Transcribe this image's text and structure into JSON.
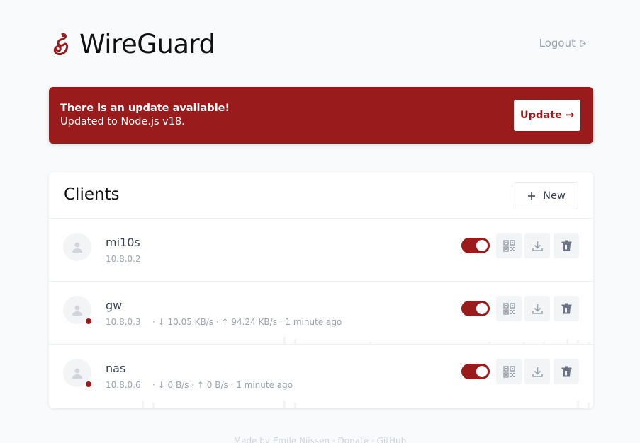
{
  "app": {
    "title": "WireGuard",
    "logout_label": "Logout",
    "accent": "#991b1b"
  },
  "banner": {
    "title": "There is an update available!",
    "message": "Updated to Node.js v18.",
    "button_label": "Update →"
  },
  "clients_card": {
    "title": "Clients",
    "new_label": "New"
  },
  "clients": [
    {
      "name": "mi10s",
      "ip": "10.8.0.2",
      "stats": "",
      "enabled": true,
      "connected": false
    },
    {
      "name": "gw",
      "ip": "10.8.0.3",
      "stats": "· ↓ 10.05 KB/s · ↑ 94.24 KB/s · 1 minute ago",
      "enabled": true,
      "connected": true
    },
    {
      "name": "nas",
      "ip": "10.8.0.6",
      "stats": "· ↓ 0 B/s · ↑ 0 B/s · 1 minute ago",
      "enabled": true,
      "connected": true
    }
  ],
  "footer": {
    "text": "Made by Emile Nijssen · Donate · GitHub"
  },
  "icons": {
    "logo": "wireguard-dragon-icon",
    "logout": "logout-icon",
    "new": "plus-icon",
    "avatar": "user-icon",
    "qr": "qr-code-icon",
    "download": "download-icon",
    "delete": "trash-icon"
  }
}
